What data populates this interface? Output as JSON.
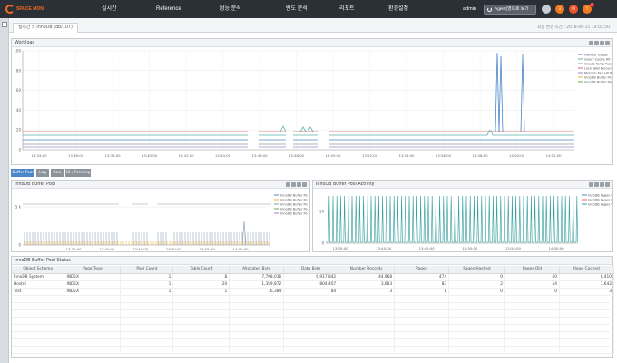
{
  "app": {
    "logo_text": "SPACE MON"
  },
  "nav": {
    "items": [
      "실시간",
      "Reference",
      "성능 분석",
      "빈도 분석",
      "리포트",
      "환경설정"
    ],
    "user": "admin",
    "agent_button": "Agent(영으로 보기"
  },
  "header_icons": [
    "circle-icon",
    "download-icon",
    "power-icon",
    "alert-icon"
  ],
  "alert_count": "0",
  "breadcrumb": "실시간 > InnoDB (db/107)",
  "last_update": "최종 변경 시간 : 2018-06-11 14:02:50",
  "workload": {
    "title": "Workload",
    "y_ticks": [
      "100",
      "80",
      "60",
      "40",
      "20",
      "0"
    ],
    "x_ticks": [
      "13:34:00",
      "13:36:00",
      "13:38:00",
      "13:40:00",
      "13:42:00",
      "13:44:00",
      "13:46:00",
      "13:48:00",
      "13:50:00",
      "13:52:00",
      "13:54:00",
      "13:56:00",
      "13:58:00",
      "14:00:00",
      "14:02:00"
    ],
    "legend": [
      "Handler Usage",
      "Query Cache Hit",
      "Create Temp Pass",
      "Lock Wait Percent",
      "MyIsam Key Hit R",
      "InnoDB Buffer Po",
      "InnoDB Buffer Pw"
    ],
    "colors": [
      "#4a86c8",
      "#5cb0b0",
      "#8a9ca8",
      "#e06666",
      "#9b8ac8",
      "#f2b233",
      "#6aa84f"
    ]
  },
  "subtabs": [
    "Buffer Pool",
    "Log",
    "Row",
    "IO / Pending"
  ],
  "buffer_pool": {
    "title": "InnoDB Buffer Pool",
    "y_ticks": [
      "5 k",
      "0"
    ],
    "x_ticks": [
      "13:35:00",
      "13:40:00",
      "13:45:00",
      "13:50:00",
      "13:55:00",
      "14:00:00"
    ],
    "legend": [
      "InnoDB Buffer Po",
      "InnoDB Buffer Po",
      "InnoDB Buffer Po",
      "InnoDB Buffer Po",
      "InnoDB Buffer Po"
    ]
  },
  "bp_activity": {
    "title": "InnoDB Buffer Pool Activity",
    "y_ticks": [
      "10",
      "0"
    ],
    "x_ticks": [
      "13:35:00",
      "13:40:00",
      "13:45:00",
      "13:50:00",
      "13:55:00",
      "14:00:00"
    ],
    "legend": [
      "InnoDB Pages Cre",
      "InnoDB Pages Rea",
      "InnoDB Pages Wri"
    ]
  },
  "status_table": {
    "title": "InnoDB Buffer Pool Status",
    "columns": [
      "Object Schema",
      "Page Type",
      "Pool Count",
      "Table Count",
      "Allocated Byte",
      "Data Byte",
      "Number Records",
      "Pages",
      "Pages Hashed",
      "Pages Old",
      "Rows Cached"
    ],
    "rows": [
      [
        "InnoDB System",
        "INDEX",
        "1",
        "8",
        "7,798,016",
        "6,917,842",
        "44,968",
        "474",
        "0",
        "60",
        "8,410"
      ],
      [
        "Hostnl",
        "INDEX",
        "1",
        "20",
        "1,359,872",
        "804,407",
        "3,683",
        "83",
        "2",
        "54",
        "1,642"
      ],
      [
        "Test",
        "INDEX",
        "1",
        "1",
        "16,384",
        "84",
        "3",
        "1",
        "0",
        "0",
        "3"
      ]
    ]
  }
}
